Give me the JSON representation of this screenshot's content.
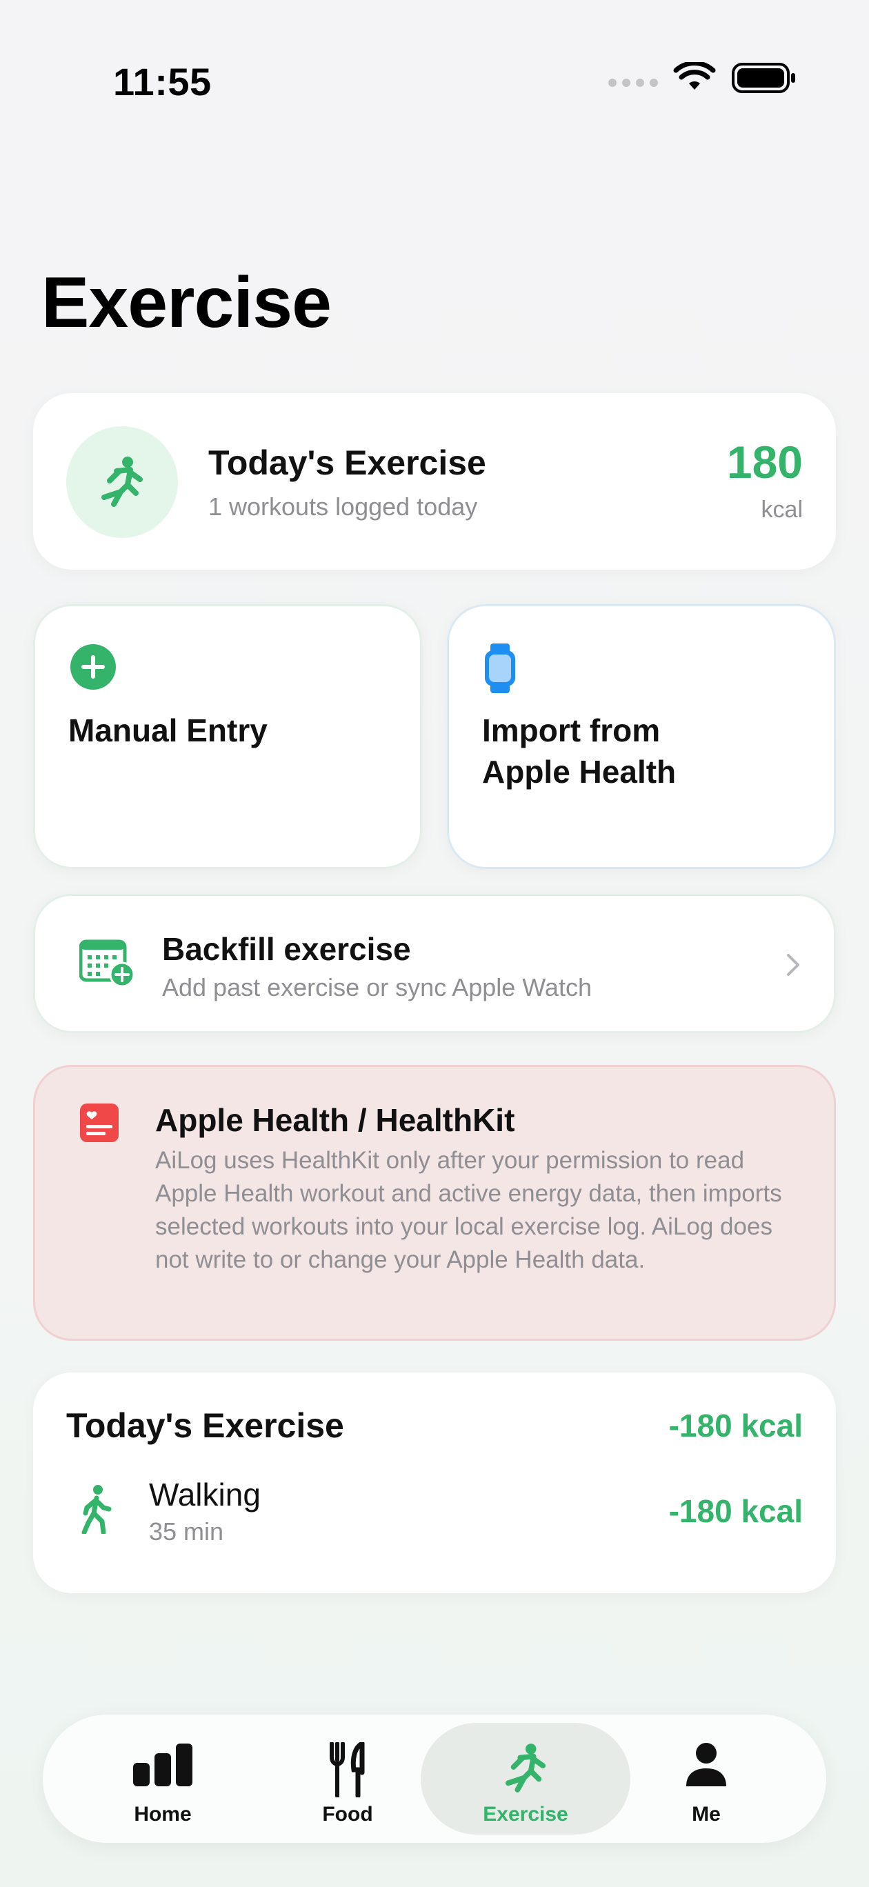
{
  "status_bar": {
    "time": "11:55"
  },
  "page": {
    "title": "Exercise"
  },
  "summary": {
    "title": "Today's Exercise",
    "subtitle": "1 workouts logged today",
    "kcal_value": "180",
    "kcal_unit": "kcal",
    "icon": "figure-run-icon"
  },
  "actions": {
    "manual": {
      "label": "Manual Entry",
      "icon": "plus-circle-icon"
    },
    "import": {
      "label_line1": "Import from",
      "label_line2": "Apple Health",
      "icon": "apple-watch-icon"
    }
  },
  "backfill": {
    "title": "Backfill exercise",
    "subtitle": "Add past exercise or sync Apple Watch",
    "icon": "calendar-plus-icon"
  },
  "healthkit": {
    "title": "Apple Health / HealthKit",
    "body": "AiLog uses HealthKit only after your permission to read Apple Health workout and active energy data, then imports selected workouts into your local exercise log. AiLog does not write to or change your Apple Health data.",
    "icon": "health-record-icon"
  },
  "today": {
    "title": "Today's Exercise",
    "total": "-180 kcal",
    "items": [
      {
        "name": "Walking",
        "duration": "35 min",
        "kcal": "-180 kcal",
        "icon": "figure-walk-icon"
      }
    ]
  },
  "tabbar": {
    "tabs": [
      {
        "label": "Home",
        "icon": "chart-bar-icon",
        "active": false
      },
      {
        "label": "Food",
        "icon": "fork-knife-icon",
        "active": false
      },
      {
        "label": "Exercise",
        "icon": "figure-run-icon",
        "active": true
      },
      {
        "label": "Me",
        "icon": "person-icon",
        "active": false
      }
    ]
  },
  "colors": {
    "accent_green": "#34b36a",
    "accent_blue": "#1e8ff0",
    "health_red": "#f04848",
    "secondary_text": "#8e8e93"
  }
}
